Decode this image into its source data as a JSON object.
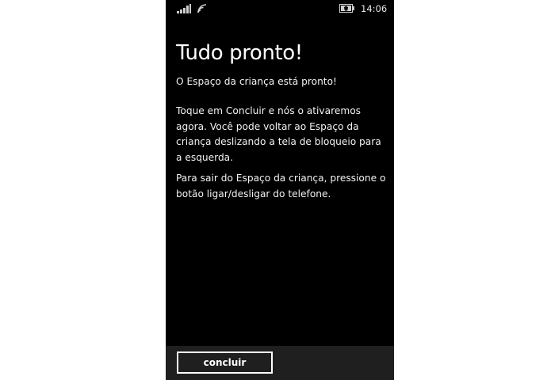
{
  "status_bar": {
    "signal_icon": "cellular-signal-icon",
    "wifi_icon": "wifi-icon",
    "battery_icon": "battery-saver-icon",
    "time": "14:06"
  },
  "content": {
    "title": "Tudo pronto!",
    "paragraphs": [
      "O Espaço da criança está pronto!",
      "Toque em Concluir e nós o ativaremos agora. Você pode voltar ao Espaço da criança deslizando a tela de bloqueio para a esquerda.",
      "Para sair do Espaço da criança, pressione o botão ligar/desligar do telefone."
    ]
  },
  "app_bar": {
    "done_label": "concluir"
  },
  "colors": {
    "background": "#000000",
    "text": "#ffffff",
    "app_bar": "#1f1f1f",
    "page_surround": "#ffffff"
  }
}
